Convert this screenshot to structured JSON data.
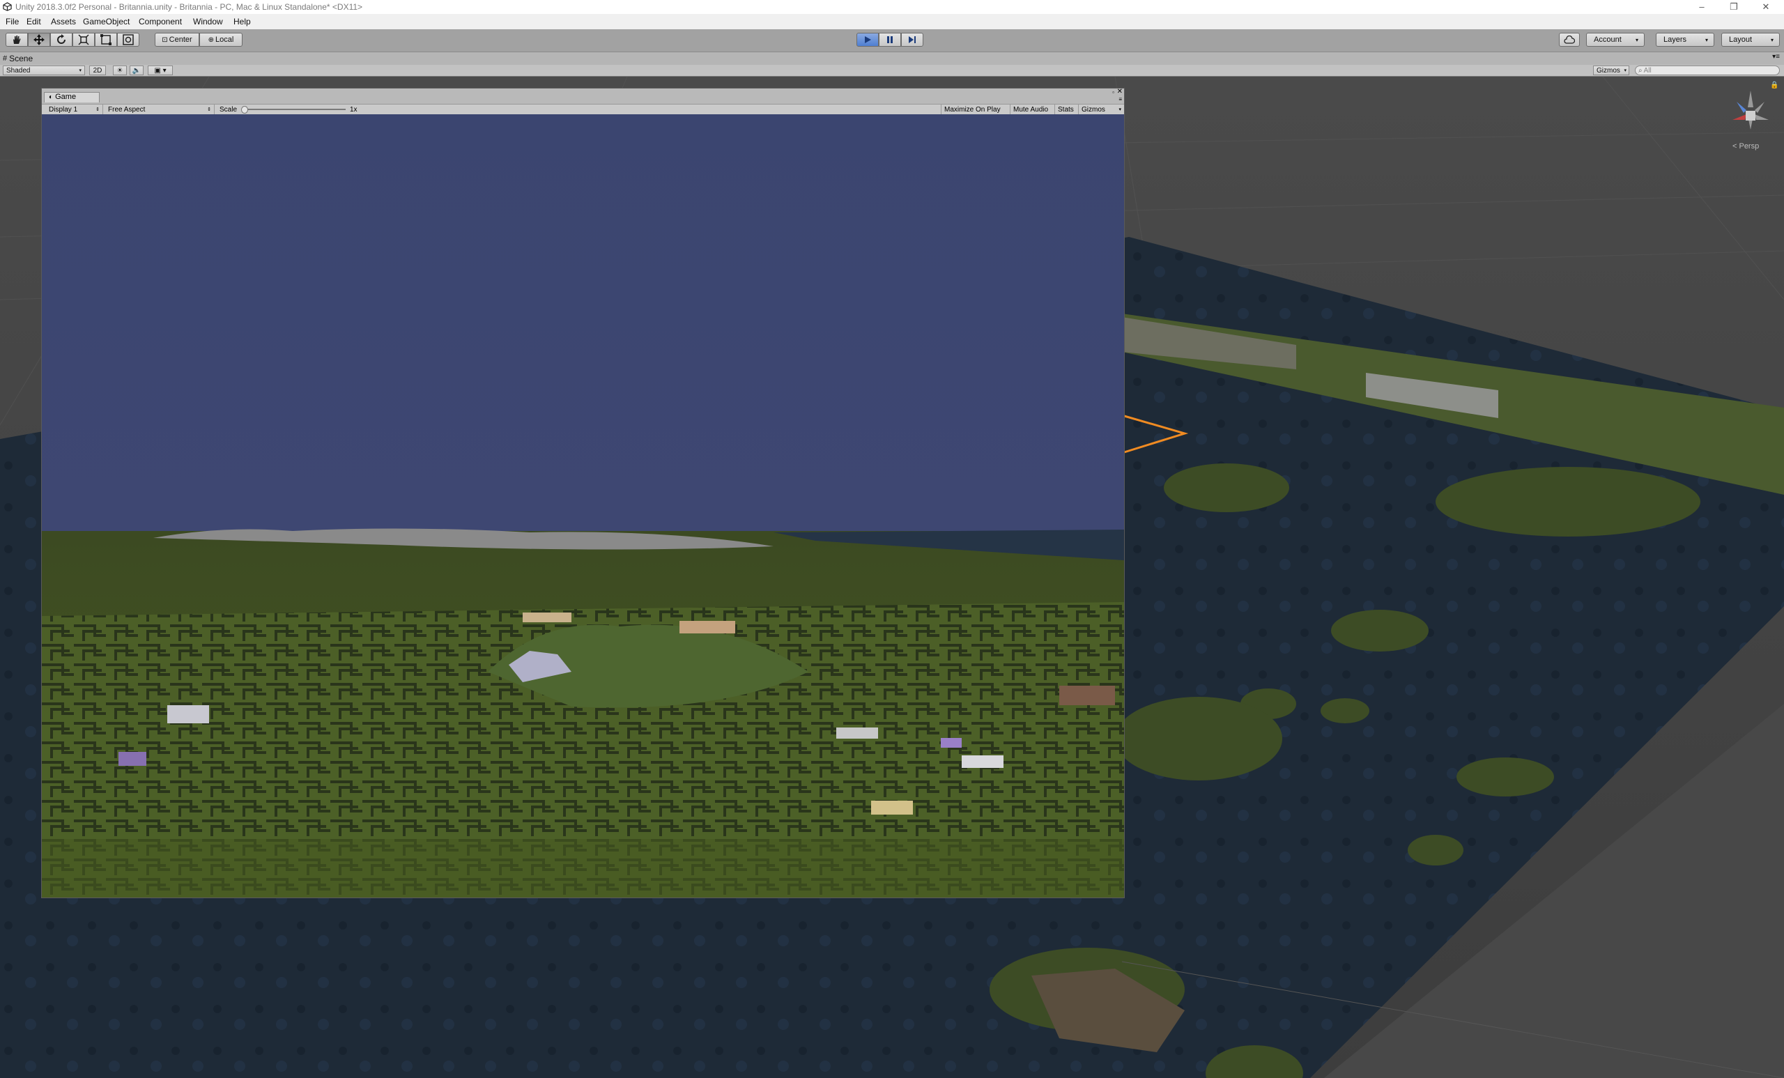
{
  "window": {
    "title": "Unity 2018.3.0f2 Personal - Britannia.unity - Britannia - PC, Mac & Linux Standalone* <DX11>",
    "controls": [
      "–",
      "❐",
      "✕"
    ]
  },
  "menu": [
    "File",
    "Edit",
    "Assets",
    "GameObject",
    "Component",
    "Window",
    "Help"
  ],
  "toolbar": {
    "pivot_label": "Center",
    "space_label": "Local",
    "account_label": "Account",
    "layers_label": "Layers",
    "layout_label": "Layout"
  },
  "scene": {
    "tab_label": "Scene",
    "shading_mode": "Shaded",
    "mode_2d": "2D",
    "gizmos_label": "Gizmos",
    "search_placeholder": "All",
    "projection_label": "< Persp"
  },
  "game": {
    "tab_label": "Game",
    "display": "Display 1",
    "aspect": "Free Aspect",
    "scale_label": "Scale",
    "scale_value": 1,
    "scale_text": "1x",
    "maximize_on_play": "Maximize On Play",
    "mute_audio": "Mute Audio",
    "stats": "Stats",
    "gizmos": "Gizmos"
  },
  "colors": {
    "sky": "#3c4570",
    "terrain": "#465a24",
    "ocean": "#1d2a38",
    "play_active": "#4f7fd2",
    "selection": "#f08b22"
  },
  "icons": {
    "unity_logo": "unity-logo-icon",
    "hand": "hand-tool-icon",
    "move": "move-tool-icon",
    "rotate": "rotate-tool-icon",
    "scale": "scale-tool-icon",
    "rect": "rect-tool-icon",
    "transform": "transform-tool-icon",
    "play": "play-icon",
    "pause": "pause-icon",
    "step": "step-icon",
    "cloud": "cloud-icon"
  }
}
